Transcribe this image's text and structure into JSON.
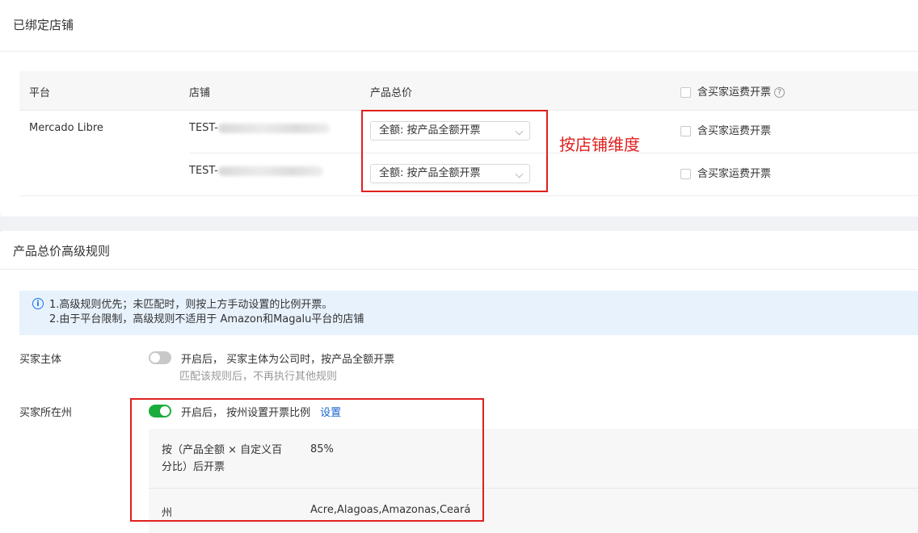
{
  "bound_stores": {
    "title": "已绑定店铺",
    "headers": {
      "platform": "平台",
      "store": "店铺",
      "total_price": "产品总价",
      "shipping_checkbox": "含买家运费开票"
    },
    "platform_name": "Mercado Libre",
    "rows": [
      {
        "store_prefix": "TEST-",
        "price_select": "全额: 按产品全额开票",
        "shipping_checkbox": "含买家运费开票"
      },
      {
        "store_prefix": "TEST-",
        "price_select": "全额: 按产品全额开票",
        "shipping_checkbox": "含买家运费开票"
      }
    ],
    "annotation": "按店铺维度"
  },
  "advanced_rules": {
    "title": "产品总价高级规则",
    "notice": {
      "line1": "1.高级规则优先；未匹配时，则按上方手动设置的比例开票。",
      "line2": "2.由于平台限制，高级规则不适用于 Amazon和Magalu平台的店铺"
    },
    "buyer_entity": {
      "label": "买家主体",
      "enabled": false,
      "description": "开启后， 买家主体为公司时，按产品全额开票",
      "hint": "匹配该规则后，不再执行其他规则"
    },
    "buyer_state": {
      "label": "买家所在州",
      "enabled": true,
      "description": "开启后， 按州设置开票比例",
      "settings_link": "设置",
      "detail": {
        "ratio_label_line1": "按（产品全额 × 自定义百",
        "ratio_label_line2": "分比）后开票",
        "ratio_value": "85%",
        "state_label": "州",
        "state_value": "Acre,Alagoas,Amazonas,Ceará"
      }
    }
  },
  "colors": {
    "accent_red": "#e0201d",
    "toggle_on": "#1aad3e",
    "link": "#1a66d2",
    "notice_bg": "#e8f2fd"
  }
}
